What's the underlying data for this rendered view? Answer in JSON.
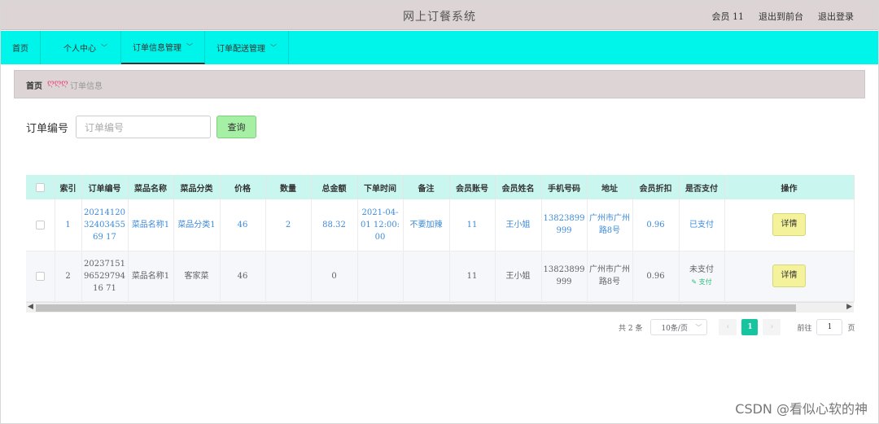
{
  "header": {
    "title": "网上订餐系统",
    "user": "会员 11",
    "back_front": "退出到前台",
    "logout": "退出登录"
  },
  "nav": [
    {
      "label": "首页",
      "has_menu": false
    },
    {
      "label": "个人中心",
      "has_menu": true
    },
    {
      "label": "订单信息管理",
      "has_menu": true,
      "active": true
    },
    {
      "label": "订单配送管理",
      "has_menu": true
    }
  ],
  "breadcrumb": {
    "home": "首页",
    "separator": "ღღღ",
    "current": "订单信息"
  },
  "search": {
    "label": "订单编号",
    "placeholder": "订单编号",
    "button": "查询"
  },
  "table": {
    "columns": [
      "索引",
      "订单编号",
      "菜品名称",
      "菜品分类",
      "价格",
      "数量",
      "总金额",
      "下单时间",
      "备注",
      "会员账号",
      "会员姓名",
      "手机号码",
      "地址",
      "会员折扣",
      "是否支付",
      "操作"
    ],
    "rows": [
      {
        "index": "1",
        "order_no": "202141203240345569 17",
        "dish": "菜品名称1",
        "category": "菜品分类1",
        "price": "46",
        "qty": "2",
        "total": "88.32",
        "time": "2021-04-01 12:00:00",
        "note": "不要加辣",
        "account": "11",
        "name": "王小姐",
        "phone": "13823899999",
        "address": "广州市广州路8号",
        "discount": "0.96",
        "paid": "已支付",
        "pay_action": "",
        "action": "详情"
      },
      {
        "index": "2",
        "order_no": "202371519652979416 71",
        "dish": "菜品名称1",
        "category": "客家菜",
        "price": "46",
        "qty": "",
        "total": "0",
        "time": "",
        "note": "",
        "account": "11",
        "name": "王小姐",
        "phone": "13823899999",
        "address": "广州市广州路8号",
        "discount": "0.96",
        "paid": "未支付",
        "pay_action": "支付",
        "action": "详情"
      }
    ]
  },
  "pager": {
    "total": "共 2 条",
    "page_size": "10条/页",
    "current": "1",
    "goto": "前往",
    "goto_value": "1",
    "page_unit": "页"
  },
  "watermark": "CSDN @看似心软的神",
  "colors": {
    "nav_bg": "#00f5ea",
    "header_bg": "#ddd5d5",
    "table_head": "#c9f7f0",
    "search_btn": "#a6f0a6",
    "detail_btn": "#f4f29a",
    "page_active": "#16c5a0"
  }
}
